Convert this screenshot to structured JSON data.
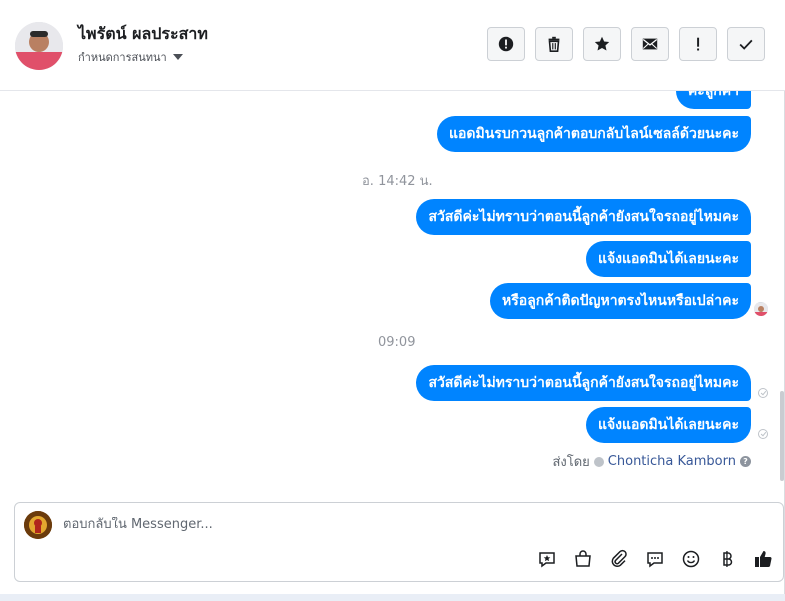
{
  "header": {
    "contact_name": "ไพรัตน์ ผลประสาท",
    "subtitle": "กำหนดการสนทนา",
    "buttons": [
      {
        "name": "mark-spam-button",
        "icon": "alert-circle-icon"
      },
      {
        "name": "delete-button",
        "icon": "trash-icon"
      },
      {
        "name": "star-button",
        "icon": "star-icon"
      },
      {
        "name": "mark-unread-button",
        "icon": "envelope-icon"
      },
      {
        "name": "follow-up-button",
        "icon": "exclamation-icon"
      },
      {
        "name": "mark-done-button",
        "icon": "checkmark-icon"
      }
    ]
  },
  "conversation": {
    "partial_message": "ค่ะลูกค้า",
    "message_earlier": "แอดมินรบกวนลูกค้าตอบกลับไลน์เซลล์ด้วยนะคะ",
    "timestamp_1": "อ. 14:42 น.",
    "group_1": [
      "สวัสดีค่ะไม่ทราบว่าตอนนี้ลูกค้ายังสนใจรถอยู่ไหมคะ",
      "แจ้งแอดมินได้เลยนะคะ",
      "หรือลูกค้าติดปัญหาตรงไหนหรือเปล่าคะ"
    ],
    "timestamp_2": "09:09",
    "group_2": [
      "สวัสดีค่ะไม่ทราบว่าตอนนี้ลูกค้ายังสนใจรถอยู่ไหมคะ",
      "แจ้งแอดมินได้เลยนะคะ"
    ],
    "sent_by_label": "ส่งโดย",
    "sent_by_name": "Chonticha Kamborn"
  },
  "composer": {
    "placeholder": "ตอบกลับใน Messenger...",
    "tools": [
      "saved-reply-icon",
      "shopping-bag-icon",
      "paperclip-icon",
      "speech-bubble-icon",
      "smiley-icon",
      "baht-icon",
      "thumbs-up-icon"
    ]
  },
  "colors": {
    "accent": "#0084ff",
    "border": "#ccd0d5",
    "muted": "#90949c"
  }
}
